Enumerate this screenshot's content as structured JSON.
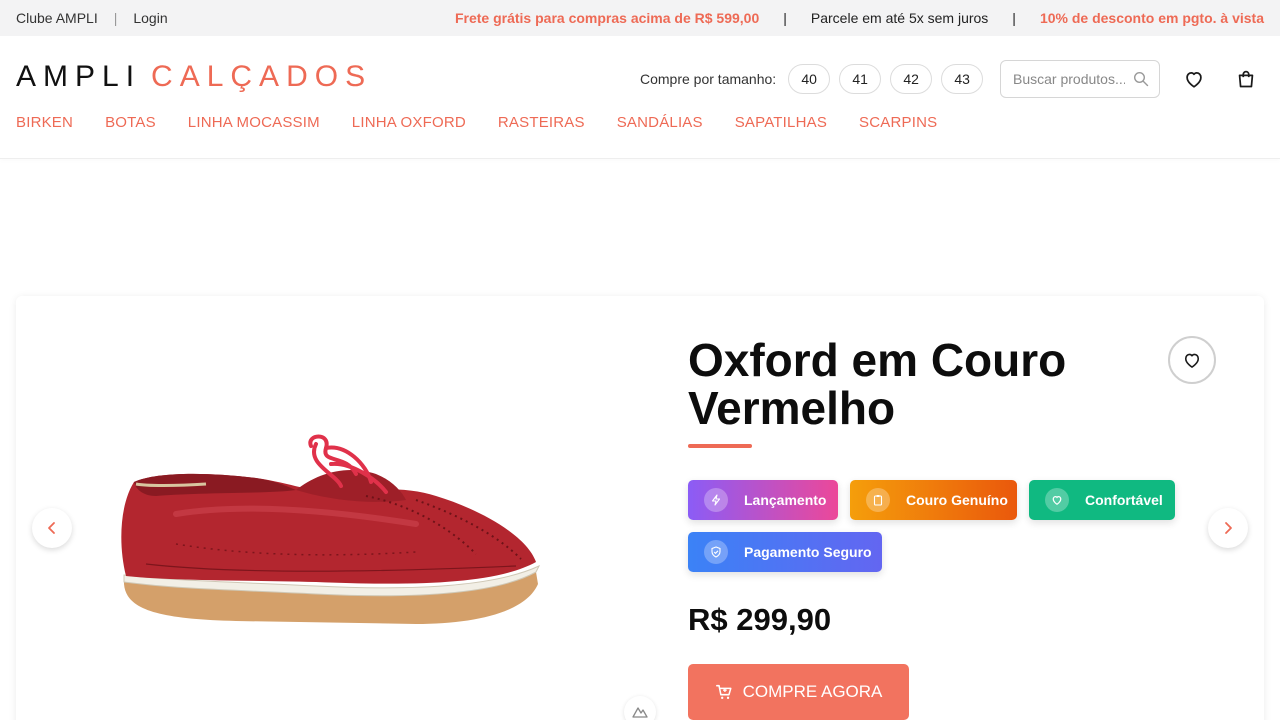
{
  "topbar": {
    "club_link": "Clube AMPLI",
    "separator": "|",
    "login_link": "Login",
    "promo_shipping": "Frete grátis para compras acima de R$ 599,00",
    "promo_installments": "Parcele em até 5x sem juros",
    "promo_discount": "10% de desconto em pgto. à vista",
    "pipe": "|",
    "accent_color": "#ee6a55"
  },
  "header": {
    "logo_primary": "AMPLI",
    "logo_secondary": "CALÇADOS",
    "sizes_label": "Compre por tamanho:",
    "sizes": [
      "40",
      "41",
      "42",
      "43"
    ],
    "search_placeholder": "Buscar produtos...",
    "icons": [
      "search-icon",
      "heart-icon",
      "shopping-bag-icon"
    ]
  },
  "nav": {
    "items": [
      "BIRKEN",
      "BOTAS",
      "LINHA MOCASSIM",
      "LINHA OXFORD",
      "RASTEIRAS",
      "SANDÁLIAS",
      "SAPATILHAS",
      "SCARPINS"
    ]
  },
  "product": {
    "title": "Oxford em Couro Vermelho",
    "price": "R$ 299,90",
    "buy_label": "COMPRE AGORA",
    "badges": [
      {
        "label": "Lançamento",
        "icon": "lightning-icon"
      },
      {
        "label": "Couro Genuíno",
        "icon": "clipboard-icon"
      },
      {
        "label": "Confortável",
        "icon": "heart-icon"
      },
      {
        "label": "Pagamento Seguro",
        "icon": "shield-icon"
      }
    ],
    "colors": {
      "lancamento_from": "#8b5cf6",
      "lancamento_to": "#ec4899",
      "couro_from": "#f59e0b",
      "couro_to": "#ea580c",
      "confortavel": "#10b981",
      "pagamento_from": "#3b82f6",
      "pagamento_to": "#6366f1",
      "buy_button": "#f2735f"
    }
  }
}
